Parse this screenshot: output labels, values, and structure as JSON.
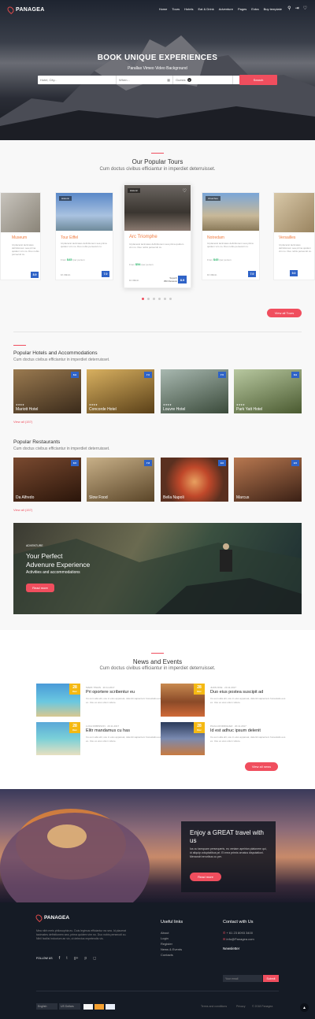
{
  "header": {
    "brand": "PANAGEA",
    "nav": [
      "Home",
      "Tours",
      "Hotels",
      "Eat & Drink",
      "Adventure",
      "Pages",
      "Extra",
      "Buy template"
    ],
    "icons": [
      "user-icon",
      "login-icon",
      "heart-icon"
    ]
  },
  "hero": {
    "title": "BOOK UNIQUE EXPERIENCES",
    "subtitle": "Parallax Vimeo Video Background",
    "search_placeholder": "Hotel, City...",
    "date_placeholder": "When...",
    "guests_label": "Guests",
    "guests_count": "1",
    "search_button": "Search"
  },
  "tours": {
    "title": "Our Popular Tours",
    "subtitle": "Cum doctus civibus efficiantur in imperdiet deterruisset.",
    "items": [
      {
        "name": "Museum",
        "tag": "",
        "desc": "Id placerat tacimates definitionem sea prima quidem vim no. Duo nobis persecuti cu.",
        "price_label": "From",
        "price": "$54",
        "price_suffix": "/per person",
        "duration": "",
        "score": "8.9",
        "score_label": "Superb",
        "score_count": "350 Reviews"
      },
      {
        "name": "Tour Eiffel",
        "tag": "Historic",
        "desc": "Id placerat tacimates definitionem sea prima quidem vim no. Duo nobis persecuti cu.",
        "price_label": "From",
        "price": "$45",
        "price_suffix": "/per person",
        "duration": "1h 30min",
        "score": "7.0",
        "score_label": "Good",
        "score_count": "350 Reviews"
      },
      {
        "name": "Arc Triomphe",
        "tag": "Historic",
        "desc": "Id placerat tacimates definitionem sea prima quidem vim no. Duo nobis persecuti cu.",
        "price_label": "From",
        "price": "$54",
        "price_suffix": "/per person",
        "duration": "1h 30min",
        "score": "8.9",
        "score_label": "Superb",
        "score_count": "350 Reviews"
      },
      {
        "name": "Notredam",
        "tag": "Churches",
        "desc": "Id placerat tacimates definitionem sea prima quidem vim no. Duo nobis persecuti cu.",
        "price_label": "From",
        "price": "$45",
        "price_suffix": "/per person",
        "duration": "1h 30min",
        "score": "7.0",
        "score_label": "Good",
        "score_count": "350 Reviews"
      },
      {
        "name": "Versailles",
        "tag": "",
        "desc": "Id placerat tacimates definitionem sea prima quidem vim no. Duo nobis persecuti cu.",
        "price_label": "From",
        "price": "$54",
        "price_suffix": "/per person",
        "duration": "",
        "score": "9.0",
        "score_label": "Superb",
        "score_count": "350 Reviews"
      }
    ],
    "view_all": "View all Tours"
  },
  "hotels": {
    "title": "Popular Hotels and Accommodations",
    "subtitle": "Cum doctus civibus efficiantur in imperdiet deterruisset.",
    "items": [
      {
        "name": "Mariott Hotel",
        "score": "8.9",
        "stars": "★★★★",
        "color": "#6a4a2a"
      },
      {
        "name": "Concorde Hotel",
        "score": "7.0",
        "stars": "★★★★",
        "color": "#8a6a30"
      },
      {
        "name": "Louvre Hotel",
        "score": "7.5",
        "stars": "★★★★",
        "color": "#5a6a5a"
      },
      {
        "name": "Park Yatt Hotel",
        "score": "8.9",
        "stars": "★★★★",
        "color": "#4a5a3a"
      }
    ],
    "view_all": "View all (157)"
  },
  "restaurants": {
    "title": "Popular Restaurants",
    "subtitle": "Cum doctus civibus efficiantur in imperdiet deterruisset.",
    "items": [
      {
        "name": "Da Alfredo",
        "score": "8.5",
        "color": "#4a2a1a"
      },
      {
        "name": "Slow Food",
        "score": "7.8",
        "color": "#6a5a3a"
      },
      {
        "name": "Bella Napoli",
        "score": "9.0",
        "color": "#b04a2a"
      },
      {
        "name": "Marcus",
        "score": "9.5",
        "color": "#5a3a2a"
      }
    ],
    "view_all": "View all (157)"
  },
  "adventure": {
    "tag": "ADVENTURE",
    "title_line1": "Your Perfect",
    "title_line2": "Advenure Experience",
    "subtitle": "Activities and accommodations",
    "button": "Read more"
  },
  "news": {
    "title": "News and Events",
    "subtitle": "Cum doctus civibus efficiantur in imperdiet deterruisset.",
    "items": [
      {
        "day": "28",
        "month": "Dec",
        "meta": "MARK TWAIN · 20.11.2017",
        "title": "Pri oportere scribentur eu",
        "text": "Cu eum alia elit, usu in eius appareat, deleniti sapientem honestatis eos ex. Usu ex eius utium videre."
      },
      {
        "day": "28",
        "month": "Dec",
        "meta": "JHON DOE · 20.11.2017",
        "title": "Duo eius postea suscipit ad",
        "text": "Cu eum alia elit, usu in eius appareat, deleniti sapientem honestatis eos ex. Usu ex eius utium videre."
      },
      {
        "day": "28",
        "month": "Dec",
        "meta": "LUCA ROBINSON · 20.11.2017",
        "title": "Elitr mandamus cu has",
        "text": "Cu eum alia elit, usu in eius appareat, deleniti sapientem honestatis eos ex. Usu ex eius utium videre."
      },
      {
        "day": "28",
        "month": "Dec",
        "meta": "PAULA RODRIGUEZ · 20.11.2017",
        "title": "Id est adhuc ipsum delenit",
        "text": "Cu eum alia elit, usu in eius appareat, deleniti sapientem honestatis eos ex. Usu ex eius utium videre."
      }
    ],
    "view_all": "View all news"
  },
  "promo": {
    "title": "Enjoy a GREAT travel with us",
    "text": "Ius cu tamquam persequeris, eu veniam apeirian platonem qui, id aliquip voluptatibus pri. Ei mea primis ornatus disputationi. Menandri erroribus cu per.",
    "button": "Read more"
  },
  "footer": {
    "brand": "PANAGEA",
    "about": "Mea nibh meis philosophia eu. Duis legimus efficiantur ea sea. Id placerat tacimates definitionem sea, prima quidem vim no. Duo nobis persecuti cu. Nihil facilisi indoctum an vix, ut delectus expetendis vis.",
    "follow_label": "FOLLOW US",
    "useful_title": "Useful links",
    "useful_links": [
      "About",
      "Login",
      "Register",
      "News & Events",
      "Contacts"
    ],
    "contact_title": "Contact with Us",
    "phone": "+ 61 23 8093 3400",
    "email": "info@Panagea.com",
    "newsletter_title": "Newsletter",
    "newsletter_placeholder": "Your email",
    "newsletter_button": "Submit",
    "language": "English",
    "currency": "US Dollars",
    "bottom_links": [
      "Terms and conditions",
      "Privacy",
      "© 2018 Panagea"
    ]
  }
}
